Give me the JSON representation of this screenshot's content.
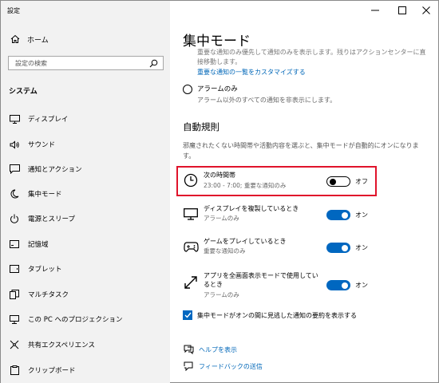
{
  "window": {
    "title": "設定"
  },
  "sidebar": {
    "home_label": "ホーム",
    "search_placeholder": "設定の検索",
    "section_title": "システム",
    "items": [
      {
        "label": "ディスプレイ",
        "icon": "monitor-icon"
      },
      {
        "label": "サウンド",
        "icon": "speaker-icon"
      },
      {
        "label": "通知とアクション",
        "icon": "notification-icon"
      },
      {
        "label": "集中モード",
        "icon": "moon-icon",
        "active": true
      },
      {
        "label": "電源とスリープ",
        "icon": "power-icon"
      },
      {
        "label": "記憶域",
        "icon": "storage-icon"
      },
      {
        "label": "タブレット",
        "icon": "tablet-icon"
      },
      {
        "label": "マルチタスク",
        "icon": "multitask-icon"
      },
      {
        "label": "この PC へのプロジェクション",
        "icon": "projection-icon"
      },
      {
        "label": "共有エクスペリエンス",
        "icon": "shared-icon"
      },
      {
        "label": "クリップボード",
        "icon": "clipboard-icon"
      }
    ]
  },
  "main": {
    "title": "集中モード",
    "faded_text": "重要な通知のみ優先して通知のみを表示します。残りはアクションセンターに直接移動します。",
    "customize_link": "重要な通知の一覧をカスタマイズする",
    "alarm_option": {
      "label": "アラームのみ",
      "sub": "アラーム以外のすべての通知を非表示にします。"
    },
    "auto_rules_title": "自動規則",
    "auto_rules_desc": "邪魔されたくない時間帯や活動内容を選ぶと、集中モードが自動的にオンになります。",
    "rules": [
      {
        "name": "次の時間帯",
        "sub": "23:00 - 7:00; 重要な通知のみ",
        "state": "オフ"
      },
      {
        "name": "ディスプレイを複製しているとき",
        "sub": "アラームのみ",
        "state": "オン"
      },
      {
        "name": "ゲームをプレイしているとき",
        "sub": "重要な通知のみ",
        "state": "オン"
      },
      {
        "name": "アプリを全画面表示モードで使用しているとき",
        "sub": "アラームのみ",
        "state": "オン"
      }
    ],
    "summary_check": "集中モードがオンの間に見逃した通知の要約を表示する",
    "help_link": "ヘルプを表示",
    "feedback_link": "フィードバックの送信"
  },
  "colors": {
    "accent": "#0067c0",
    "highlight": "#e0132b",
    "sidebar_bg": "#f2f2f2"
  }
}
